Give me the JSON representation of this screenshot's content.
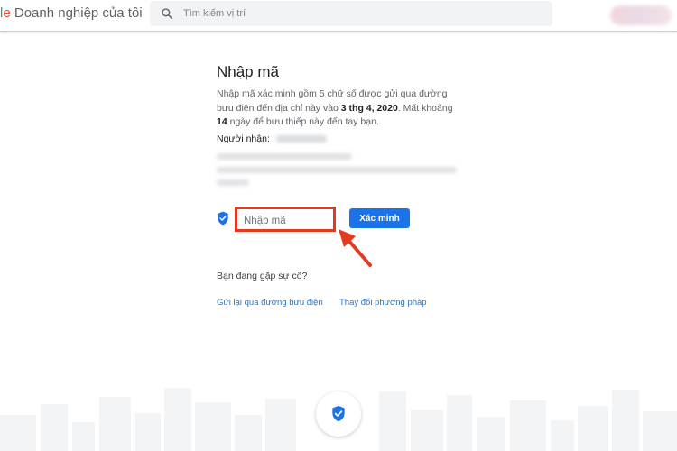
{
  "header": {
    "brand_prefix_l": "l",
    "brand_prefix_e": "e",
    "brand_title": " Doanh nghiệp của tôi",
    "search_placeholder": "Tìm kiếm vị trí"
  },
  "verify": {
    "title": "Nhập mã",
    "desc_part1": "Nhập mã xác minh gồm 5 chữ số được gửi qua đường bưu điện đến địa chỉ này vào ",
    "desc_date": "3 thg 4, 2020",
    "desc_part2": ". Mất khoảng ",
    "desc_days": "14",
    "desc_part3": " ngày để bưu thiếp này đến tay bạn.",
    "recipient_label": "Người nhận:",
    "code_placeholder": "Nhập mã",
    "verify_button": "Xác minh",
    "trouble_text": "Bạn đang gặp sự cố?",
    "link_resend": "Gửi lại qua đường bưu điện",
    "link_change": "Thay đổi phương pháp"
  },
  "colors": {
    "accent": "#1a73e8",
    "highlight": "#e53922"
  },
  "icons": [
    "search-icon",
    "shield-check-icon",
    "red-arrow-annotation",
    "city-skyline-illustration"
  ]
}
